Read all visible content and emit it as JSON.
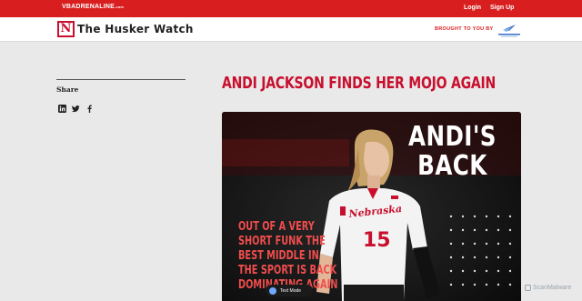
{
  "topbar": {
    "logo": "VBADRENALINE",
    "logo_suffix": ".com",
    "login": "Login",
    "signup": "Sign Up"
  },
  "brand": {
    "mark": "N",
    "title": "The Husker Watch",
    "sponsor_label": "BROUGHT TO YOU BY"
  },
  "sidebar": {
    "share_label": "Share",
    "share_icons": [
      "linkedin-icon",
      "twitter-icon",
      "facebook-icon"
    ]
  },
  "article": {
    "headline": "ANDI JACKSON FINDS HER MOJO AGAIN",
    "hero": {
      "title": "ANDI'S\nBACK",
      "subtitle": "OUT OF A VERY\nSHORT FUNK THE\nBEST MIDDLE IN\nTHE SPORT IS BACK\nDOMINATING AGAIN",
      "jersey_number": "15",
      "jersey_text": "Nebraska"
    }
  },
  "overlays": {
    "text_mode": "Text Mode",
    "scanmalware": "ScanMalware"
  },
  "colors": {
    "brand_red": "#d81e1e",
    "headline_red": "#c8102e",
    "subtitle_red": "#f04d4d"
  }
}
